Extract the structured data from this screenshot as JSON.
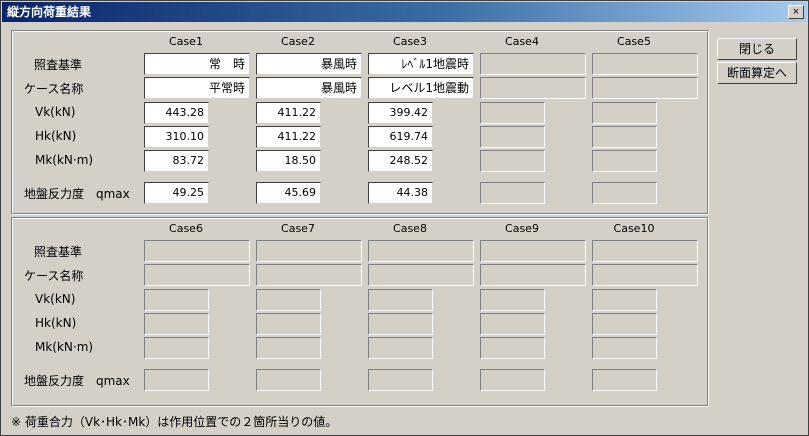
{
  "window": {
    "title": "縦方向荷重結果",
    "close_glyph": "×"
  },
  "buttons": {
    "close": "閉じる",
    "section_calc": "断面算定へ"
  },
  "row_labels": {
    "criteria": "照査基準",
    "case_name": "ケース名称",
    "vk": "Vk(kN)",
    "hk": "Hk(kN)",
    "mk": "Mk(kN·m)",
    "qmax": "地盤反力度　qmax"
  },
  "top": {
    "cases": [
      {
        "header": "Case1",
        "criteria": "常　時",
        "name": "平常時",
        "vk": "443.28",
        "hk": "310.10",
        "mk": "83.72",
        "qmax": "49.25"
      },
      {
        "header": "Case2",
        "criteria": "暴風時",
        "name": "暴風時",
        "vk": "411.22",
        "hk": "411.22",
        "mk": "18.50",
        "qmax": "45.69"
      },
      {
        "header": "Case3",
        "criteria": "ﾚﾍﾞﾙ1地震時",
        "name": "レベル1地震動",
        "vk": "399.42",
        "hk": "619.74",
        "mk": "248.52",
        "qmax": "44.38"
      },
      {
        "header": "Case4"
      },
      {
        "header": "Case5"
      }
    ]
  },
  "bottom": {
    "cases": [
      {
        "header": "Case6"
      },
      {
        "header": "Case7"
      },
      {
        "header": "Case8"
      },
      {
        "header": "Case9"
      },
      {
        "header": "Case10"
      }
    ]
  },
  "footnote": "※ 荷重合力（Vk･Hk･Mk）は作用位置での２箇所当りの値。"
}
